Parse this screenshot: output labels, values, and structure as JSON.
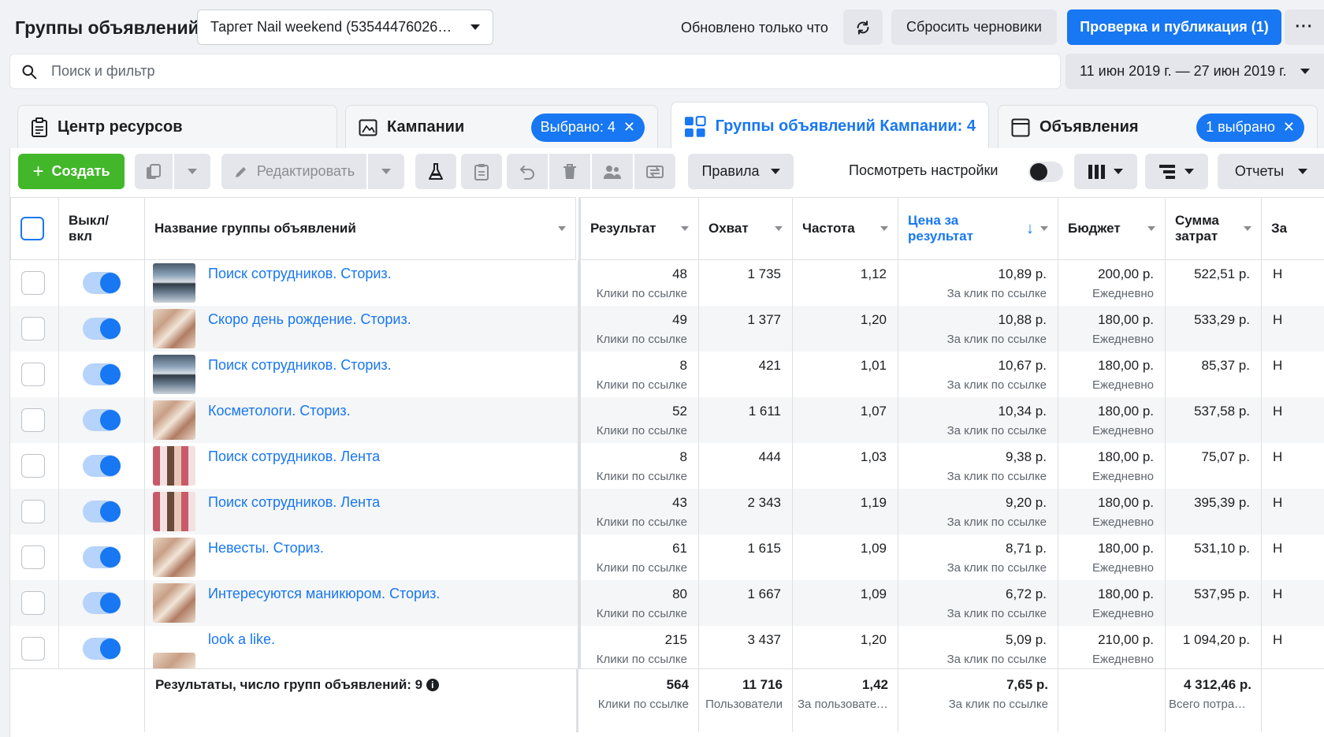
{
  "header": {
    "title": "Группы объявлений",
    "campaign_select": "Таргет Nail weekend (535444760265...",
    "updated": "Обновлено только что",
    "discard_label": "Сбросить черновики",
    "publish_label": "Проверка и публикация (1)",
    "more_label": "···"
  },
  "search": {
    "placeholder": "Поиск и фильтр",
    "date_range": "11 июн 2019 г. — 27 июн 2019 г."
  },
  "tabs": [
    {
      "label": "Центр ресурсов",
      "pill": ""
    },
    {
      "label": "Кампании",
      "pill": "Выбрано: 4"
    },
    {
      "label": "Группы объявлений Кампании: 4",
      "pill": ""
    },
    {
      "label": "Объявления",
      "pill": "1 выбрано"
    }
  ],
  "toolbar": {
    "create_label": "Создать",
    "edit_label": "Редактировать",
    "rules_label": "Правила",
    "view_settings_label": "Посмотреть настройки",
    "reports_label": "Отчеты"
  },
  "columns": {
    "onoff": "Выкл/ вкл",
    "name": "Название группы объявлений",
    "result": "Результат",
    "reach": "Охват",
    "frequency": "Частота",
    "cost": "Цена за результат",
    "budget": "Бюджет",
    "spent": "Сумма затрат",
    "next": "За"
  },
  "rows": [
    {
      "name": "Поиск сотрудников. Сториз.",
      "thumb": "people",
      "result": "48",
      "result_sub": "Клики по ссылке",
      "reach": "1 735",
      "frequency": "1,12",
      "cost": "10,89 р.",
      "cost_sub": "За клик по ссылке",
      "budget": "200,00 р.",
      "budget_sub": "Ежедневно",
      "spent": "522,51 р.",
      "next": "Н"
    },
    {
      "name": "Скоро день рождение. Сториз.",
      "thumb": "nails",
      "result": "49",
      "result_sub": "Клики по ссылке",
      "reach": "1 377",
      "frequency": "1,20",
      "cost": "10,88 р.",
      "cost_sub": "За клик по ссылке",
      "budget": "180,00 р.",
      "budget_sub": "Ежедневно",
      "spent": "533,29 р.",
      "next": "Н"
    },
    {
      "name": "Поиск сотрудников. Сториз.",
      "thumb": "people",
      "result": "8",
      "result_sub": "Клики по ссылке",
      "reach": "421",
      "frequency": "1,01",
      "cost": "10,67 р.",
      "cost_sub": "За клик по ссылке",
      "budget": "180,00 р.",
      "budget_sub": "Ежедневно",
      "spent": "85,37 р.",
      "next": "Н"
    },
    {
      "name": "Косметологи. Сториз.",
      "thumb": "nails",
      "result": "52",
      "result_sub": "Клики по ссылке",
      "reach": "1 611",
      "frequency": "1,07",
      "cost": "10,34 р.",
      "cost_sub": "За клик по ссылке",
      "budget": "180,00 р.",
      "budget_sub": "Ежедневно",
      "spent": "537,58 р.",
      "next": "Н"
    },
    {
      "name": "Поиск сотрудников. Лента",
      "thumb": "collage",
      "result": "8",
      "result_sub": "Клики по ссылке",
      "reach": "444",
      "frequency": "1,03",
      "cost": "9,38 р.",
      "cost_sub": "За клик по ссылке",
      "budget": "180,00 р.",
      "budget_sub": "Ежедневно",
      "spent": "75,07 р.",
      "next": "Н"
    },
    {
      "name": "Поиск сотрудников. Лента",
      "thumb": "collage",
      "result": "43",
      "result_sub": "Клики по ссылке",
      "reach": "2 343",
      "frequency": "1,19",
      "cost": "9,20 р.",
      "cost_sub": "За клик по ссылке",
      "budget": "180,00 р.",
      "budget_sub": "Ежедневно",
      "spent": "395,39 р.",
      "next": "Н"
    },
    {
      "name": "Невесты. Сториз.",
      "thumb": "nails",
      "result": "61",
      "result_sub": "Клики по ссылке",
      "reach": "1 615",
      "frequency": "1,09",
      "cost": "8,71 р.",
      "cost_sub": "За клик по ссылке",
      "budget": "180,00 р.",
      "budget_sub": "Ежедневно",
      "spent": "531,10 р.",
      "next": "Н"
    },
    {
      "name": "Интересуются маникюром. Сториз.",
      "thumb": "nails",
      "result": "80",
      "result_sub": "Клики по ссылке",
      "reach": "1 667",
      "frequency": "1,09",
      "cost": "6,72 р.",
      "cost_sub": "За клик по ссылке",
      "budget": "180,00 р.",
      "budget_sub": "Ежедневно",
      "spent": "537,95 р.",
      "next": "Н"
    },
    {
      "name": "look a like.",
      "thumb": "single",
      "result": "215",
      "result_sub": "Клики по ссылке",
      "reach": "3 437",
      "frequency": "1,20",
      "cost": "5,09 р.",
      "cost_sub": "За клик по ссылке",
      "budget": "210,00 р.",
      "budget_sub": "Ежедневно",
      "spent": "1 094,20 р.",
      "next": "Н"
    }
  ],
  "totals": {
    "label": "Результаты, число групп объявлений: 9",
    "result": "564",
    "result_sub": "Клики по ссылке",
    "reach": "11 716",
    "reach_sub": "Пользователи",
    "frequency": "1,42",
    "frequency_sub": "За пользователя",
    "cost": "7,65 р.",
    "cost_sub": "За клик по ссылке",
    "spent": "4 312,46 р.",
    "spent_sub": "Всего потрачено"
  },
  "colors": {
    "accent": "#1877f2",
    "create": "#42b72a"
  }
}
